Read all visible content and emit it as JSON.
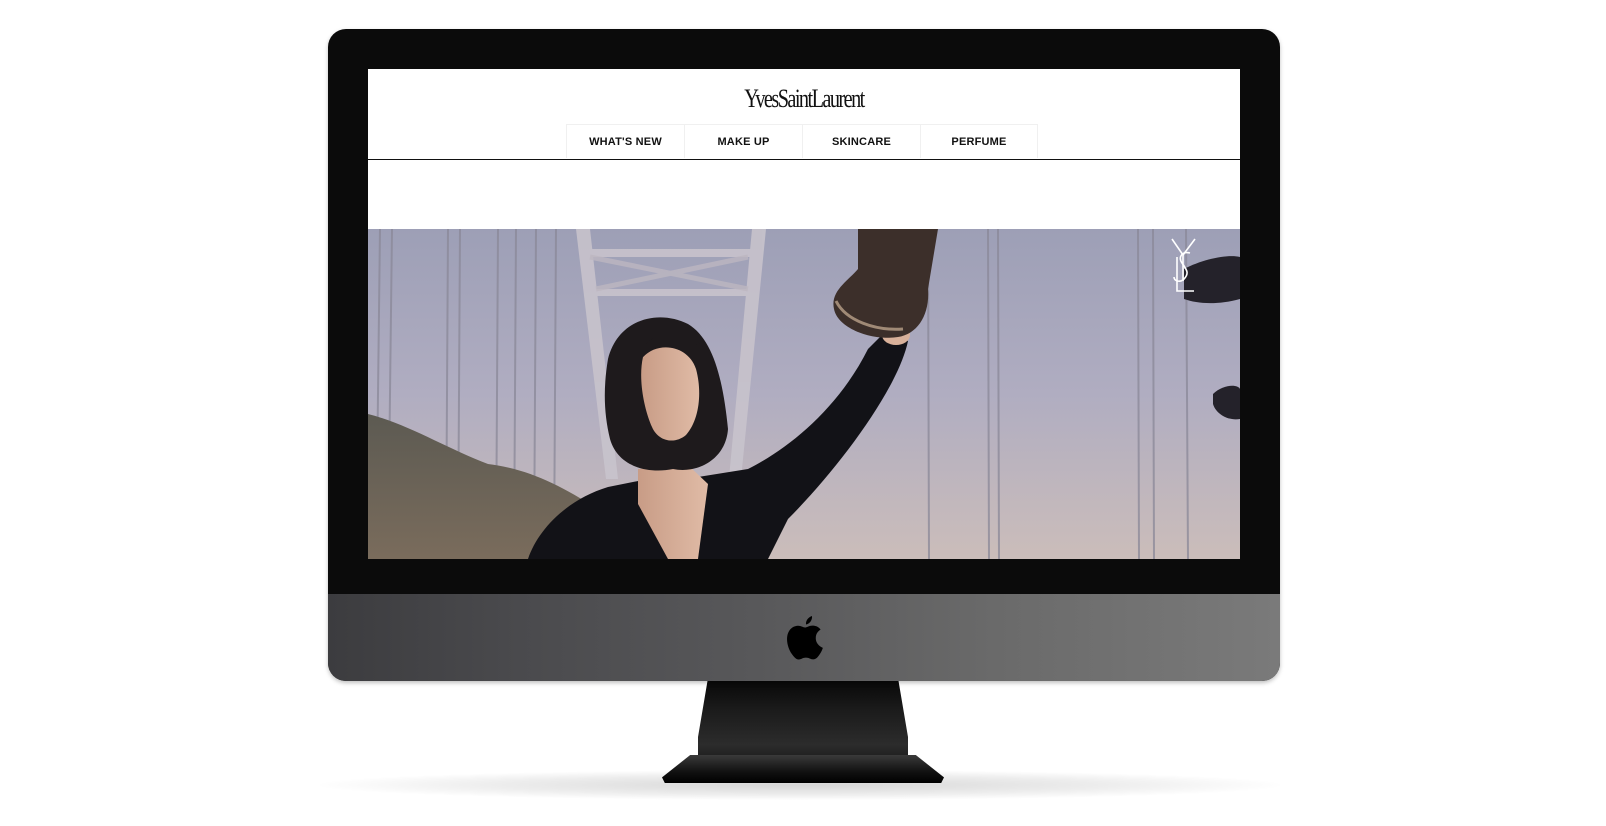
{
  "brand": {
    "logo_text": "YvesSaintLaurent",
    "monogram_text": "YSL"
  },
  "nav": {
    "items": [
      {
        "label": "WHAT'S NEW"
      },
      {
        "label": "MAKE UP"
      },
      {
        "label": "SKINCARE"
      },
      {
        "label": "PERFUME"
      }
    ]
  },
  "hero": {
    "media_type": "video-still"
  },
  "device": {
    "type": "desktop-monitor",
    "chin_icon": "apple-logo-icon"
  },
  "colors": {
    "bezel": "#0b0b0b",
    "chin": "#5a5a5c",
    "nav_text": "#111111",
    "header_divider": "#111111",
    "sky": "#a9a8bd"
  }
}
